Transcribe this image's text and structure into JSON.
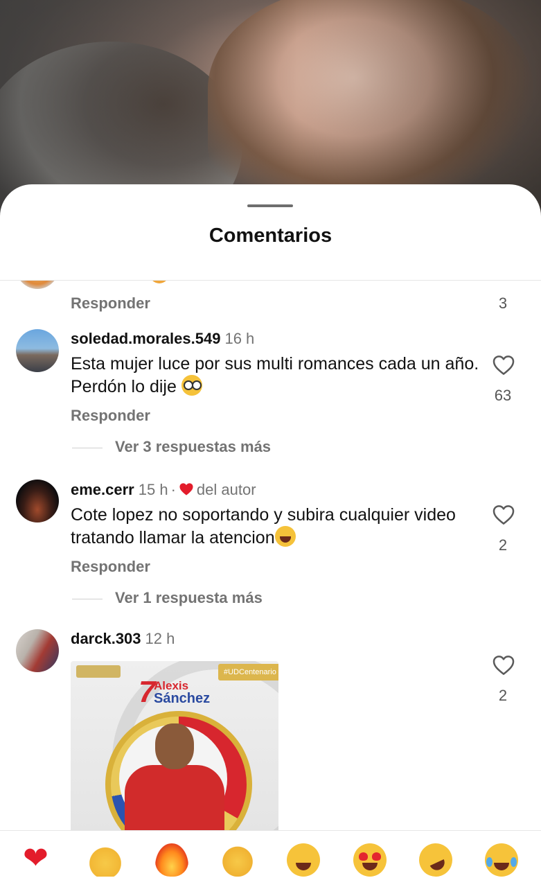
{
  "sheet": {
    "title": "Comentarios"
  },
  "reply_label": "Responder",
  "partial_comment": {
    "likes": "3"
  },
  "comments": [
    {
      "username": "soledad.morales.549",
      "time": "16 h",
      "text": "Esta mujer luce por sus multi romances cada un año. Perdón lo dije",
      "trailing_emoji": "nerd-face-emoji",
      "likes": "63",
      "view_replies": "Ver 3 respuestas más"
    },
    {
      "username": "eme.cerr",
      "time": "15 h",
      "separator": "·",
      "author_badge": "del autor",
      "text": "Cote lopez no soportando y subira cualquier video tratando llamar la atencion",
      "trailing_emoji": "tears-of-joy-emoji",
      "likes": "2",
      "view_replies": "Ver 1 respuesta más"
    },
    {
      "username": "darck.303",
      "time": "12 h",
      "likes": "2",
      "sticker": {
        "number": "7",
        "first_name": "Alexis",
        "last_name": "Sánchez",
        "tag": "#UDCentenario"
      }
    }
  ],
  "emoji_bar": [
    "red-heart",
    "raising-hands",
    "fire",
    "clapping-hands",
    "smiling-face-with-hearts",
    "heart-eyes",
    "rolling-on-floor-laughing",
    "tears-of-joy"
  ],
  "colors": {
    "accent_red": "#e31c2b",
    "muted_text": "#737373",
    "text": "#111111"
  }
}
